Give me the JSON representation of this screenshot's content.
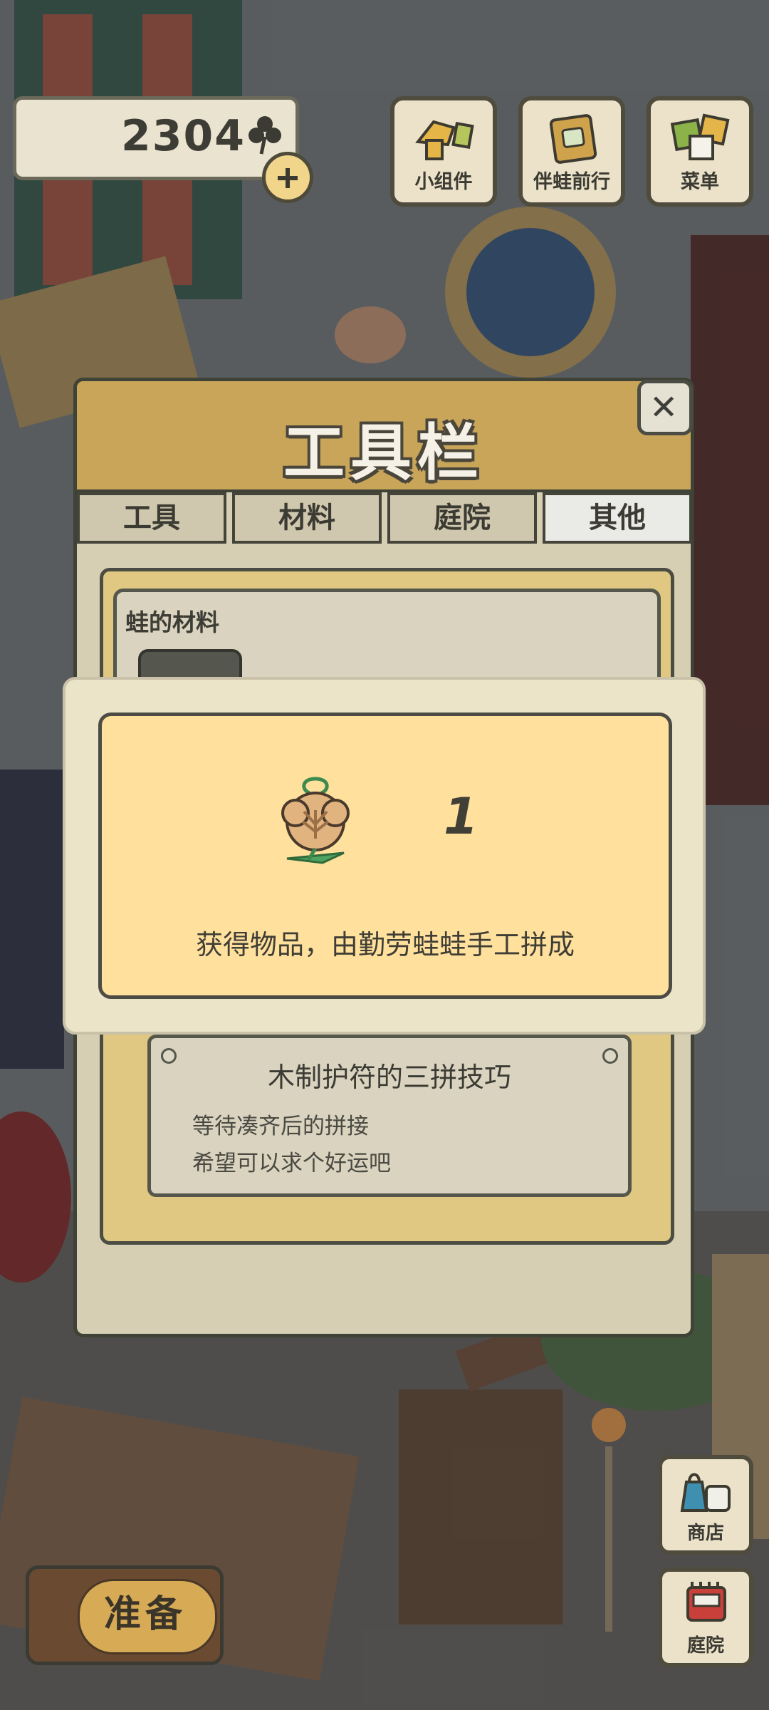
{
  "hud": {
    "clover_count": "2304",
    "top_buttons": [
      {
        "label": "小组件",
        "icon": "widget-icon"
      },
      {
        "label": "伴蛙前行",
        "icon": "journey-book-icon"
      },
      {
        "label": "菜单",
        "icon": "menu-icon"
      }
    ]
  },
  "toolbar": {
    "title": "工具栏",
    "tabs": [
      {
        "label": "工具",
        "active": false
      },
      {
        "label": "材料",
        "active": false
      },
      {
        "label": "庭院",
        "active": false
      },
      {
        "label": "其他",
        "active": true
      }
    ],
    "section_title": "蛙的材料",
    "item_description": {
      "title": "木制护符的三拼技巧",
      "lines": [
        "等待凑齐后的拼接",
        "希望可以求个好运吧"
      ]
    }
  },
  "reward_popup": {
    "icon": "wooden-charm-icon",
    "count": "1",
    "message": "获得物品，由勤劳蛙蛙手工拼成"
  },
  "bottom": {
    "ready_label": "准备",
    "shop_label": "商店",
    "courtyard_label": "庭院"
  },
  "colors": {
    "panel_header": "#c9a55a",
    "popup_fill": "#ffe09d",
    "active_tab": "#eaeae6"
  }
}
